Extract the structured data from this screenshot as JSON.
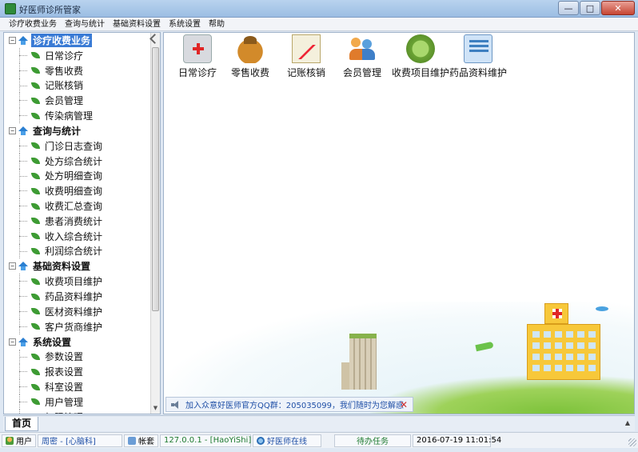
{
  "window": {
    "title": "好医师诊所管家"
  },
  "menu": [
    "诊疗收费业务",
    "查询与统计",
    "基础资料设置",
    "系统设置",
    "帮助"
  ],
  "tree": [
    {
      "label": "诊疗收费业务",
      "selected": true,
      "items": [
        "日常诊疗",
        "零售收费",
        "记账核销",
        "会员管理",
        "传染病管理"
      ]
    },
    {
      "label": "查询与统计",
      "selected": false,
      "items": [
        "门诊日志查询",
        "处方综合统计",
        "处方明细查询",
        "收费明细查询",
        "收费汇总查询",
        "患者消费统计",
        "收入综合统计",
        "利润综合统计"
      ]
    },
    {
      "label": "基础资料设置",
      "selected": false,
      "items": [
        "收费项目维护",
        "药品资料维护",
        "医材资料维护",
        "客户货商维护"
      ]
    },
    {
      "label": "系统设置",
      "selected": false,
      "items": [
        "参数设置",
        "报表设置",
        "科室设置",
        "用户管理",
        "权限管理"
      ]
    }
  ],
  "modules": [
    {
      "label": "日常诊疗",
      "icon": "medical-kit-icon"
    },
    {
      "label": "零售收费",
      "icon": "money-bag-icon"
    },
    {
      "label": "记账核销",
      "icon": "ledger-chart-icon"
    },
    {
      "label": "会员管理",
      "icon": "members-icon"
    },
    {
      "label": "收费项目维护",
      "icon": "fee-items-icon"
    },
    {
      "label": "药品资料维护",
      "icon": "drug-data-icon"
    }
  ],
  "notice": {
    "text": "加入众意好医师官方QQ群：205035099，我们随时为您解惑"
  },
  "tabs": {
    "home": "首页"
  },
  "status": {
    "user_label": "用户",
    "user_value": "周密 - [心脑科]",
    "account_label": "帐套",
    "account_value": "127.0.0.1 - [HaoYiShi]",
    "online": "好医师在线",
    "pending": "待办任务",
    "datetime": "2016-07-19 11:01:54"
  }
}
